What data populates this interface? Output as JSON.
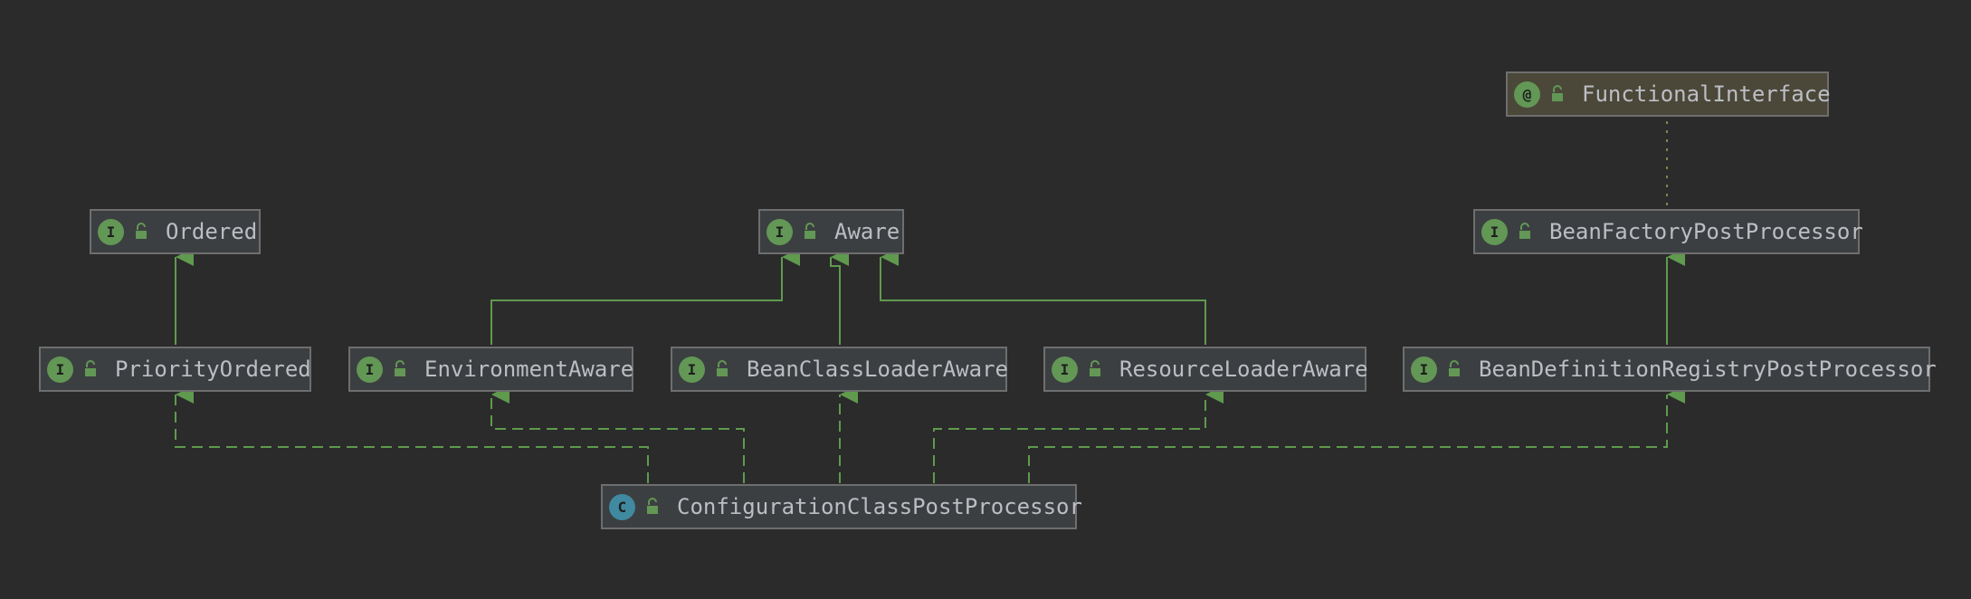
{
  "diagram": {
    "nodes": {
      "functional_interface": {
        "label": "FunctionalInterface",
        "kind": "@"
      },
      "ordered": {
        "label": "Ordered",
        "kind": "I"
      },
      "aware": {
        "label": "Aware",
        "kind": "I"
      },
      "bean_factory_post_processor": {
        "label": "BeanFactoryPostProcessor",
        "kind": "I"
      },
      "priority_ordered": {
        "label": "PriorityOrdered",
        "kind": "I"
      },
      "environment_aware": {
        "label": "EnvironmentAware",
        "kind": "I"
      },
      "bean_class_loader_aware": {
        "label": "BeanClassLoaderAware",
        "kind": "I"
      },
      "resource_loader_aware": {
        "label": "ResourceLoaderAware",
        "kind": "I"
      },
      "bean_definition_registry_post_processor": {
        "label": "BeanDefinitionRegistryPostProcessor",
        "kind": "I"
      },
      "configuration_class_post_processor": {
        "label": "ConfigurationClassPostProcessor",
        "kind": "C"
      }
    },
    "colors": {
      "background": "#2b2b2b",
      "node_fill": "#3c3f41",
      "annotation_fill": "#4b4839",
      "node_border": "#6e6e6e",
      "text": "#bcbec4",
      "edge": "#5f9a4e",
      "interface_icon": "#629755",
      "class_icon": "#3f8aa0"
    }
  }
}
